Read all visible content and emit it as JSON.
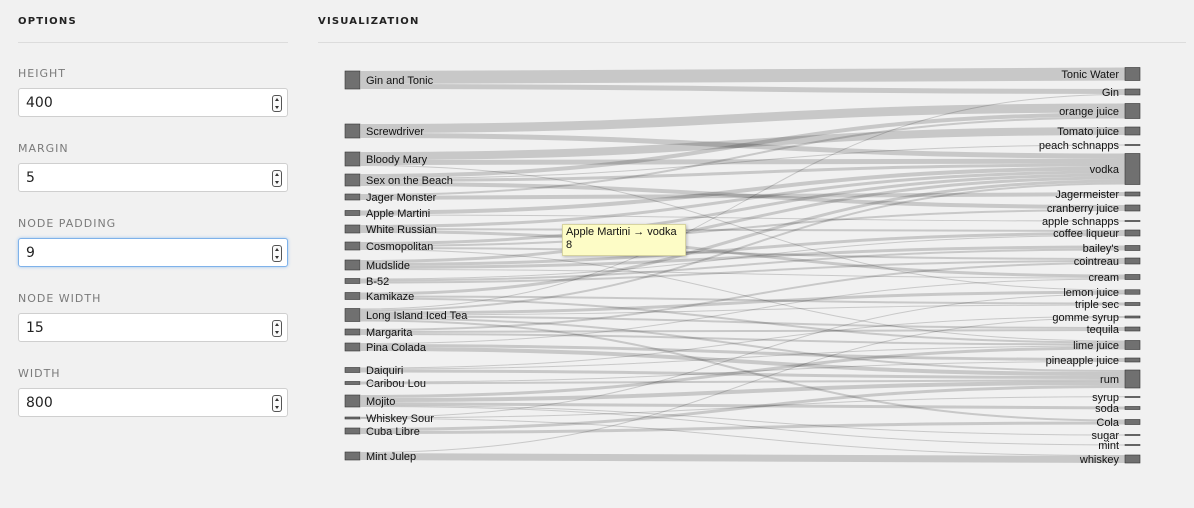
{
  "options": {
    "title": "OPTIONS",
    "fields": [
      {
        "label": "HEIGHT",
        "value": "400"
      },
      {
        "label": "MARGIN",
        "value": "5"
      },
      {
        "label": "NODE PADDING",
        "value": "9"
      },
      {
        "label": "NODE WIDTH",
        "value": "15"
      },
      {
        "label": "WIDTH",
        "value": "800"
      }
    ]
  },
  "visualization": {
    "title": "VISUALIZATION"
  },
  "tooltip": {
    "link": "Apple Martini → vodka",
    "value": "8"
  },
  "colors": {
    "node": "#707070",
    "node_border": "#333333",
    "link": "#000000",
    "tooltip_bg": "#fdfcc6"
  },
  "chart_data": {
    "type": "sankey",
    "sources": [
      "Gin and Tonic",
      "Screwdriver",
      "Bloody Mary",
      "Sex on the Beach",
      "Jager Monster",
      "Apple Martini",
      "White Russian",
      "Cosmopolitan",
      "Mudslide",
      "B-52",
      "Kamikaze",
      "Long Island Iced Tea",
      "Margarita",
      "Pina Colada",
      "Daiquiri",
      "Caribou Lou",
      "Mojito",
      "Whiskey Sour",
      "Cuba Libre",
      "Mint Julep"
    ],
    "targets": [
      "Tonic Water",
      "Gin",
      "orange juice",
      "Tomato juice",
      "peach schnapps",
      "vodka",
      "Jagermeister",
      "cranberry juice",
      "apple schnapps",
      "coffee liqueur",
      "bailey's",
      "cointreau",
      "cream",
      "lemon juice",
      "triple sec",
      "gomme syrup",
      "tequila",
      "lime juice",
      "pineapple juice",
      "rum",
      "syrup",
      "soda",
      "Cola",
      "sugar",
      "mint",
      "whiskey"
    ],
    "links": [
      [
        "Gin and Tonic",
        "Tonic Water",
        26
      ],
      [
        "Gin and Tonic",
        "Gin",
        10
      ],
      [
        "Screwdriver",
        "vodka",
        10
      ],
      [
        "Screwdriver",
        "orange juice",
        18
      ],
      [
        "Bloody Mary",
        "vodka",
        10
      ],
      [
        "Bloody Mary",
        "Tomato juice",
        16
      ],
      [
        "Bloody Mary",
        "lemon juice",
        2
      ],
      [
        "Sex on the Beach",
        "vodka",
        6
      ],
      [
        "Sex on the Beach",
        "peach schnapps",
        2
      ],
      [
        "Sex on the Beach",
        "orange juice",
        8
      ],
      [
        "Sex on the Beach",
        "cranberry juice",
        8
      ],
      [
        "Jager Monster",
        "Jagermeister",
        8
      ],
      [
        "Jager Monster",
        "orange juice",
        4
      ],
      [
        "Apple Martini",
        "vodka",
        8
      ],
      [
        "Apple Martini",
        "apple schnapps",
        2
      ],
      [
        "White Russian",
        "vodka",
        6
      ],
      [
        "White Russian",
        "coffee liqueur",
        4
      ],
      [
        "White Russian",
        "cream",
        6
      ],
      [
        "Cosmopolitan",
        "vodka",
        6
      ],
      [
        "Cosmopolitan",
        "cointreau",
        4
      ],
      [
        "Cosmopolitan",
        "cranberry juice",
        4
      ],
      [
        "Cosmopolitan",
        "lime juice",
        2
      ],
      [
        "Mudslide",
        "vodka",
        6
      ],
      [
        "Mudslide",
        "coffee liqueur",
        6
      ],
      [
        "Mudslide",
        "bailey's",
        6
      ],
      [
        "Mudslide",
        "cream",
        2
      ],
      [
        "B-52",
        "coffee liqueur",
        2
      ],
      [
        "B-52",
        "bailey's",
        4
      ],
      [
        "B-52",
        "cointreau",
        4
      ],
      [
        "Kamikaze",
        "vodka",
        6
      ],
      [
        "Kamikaze",
        "triple sec",
        4
      ],
      [
        "Kamikaze",
        "lime juice",
        4
      ],
      [
        "Long Island Iced Tea",
        "vodka",
        4
      ],
      [
        "Long Island Iced Tea",
        "Gin",
        2
      ],
      [
        "Long Island Iced Tea",
        "tequila",
        4
      ],
      [
        "Long Island Iced Tea",
        "rum",
        4
      ],
      [
        "Long Island Iced Tea",
        "triple sec",
        2
      ],
      [
        "Long Island Iced Tea",
        "Cola",
        4
      ],
      [
        "Long Island Iced Tea",
        "lemon juice",
        6
      ],
      [
        "Margarita",
        "tequila",
        4
      ],
      [
        "Margarita",
        "cointreau",
        4
      ],
      [
        "Margarita",
        "lime juice",
        4
      ],
      [
        "Pina Colada",
        "rum",
        8
      ],
      [
        "Pina Colada",
        "pineapple juice",
        6
      ],
      [
        "Pina Colada",
        "cream",
        2
      ],
      [
        "Daiquiri",
        "rum",
        6
      ],
      [
        "Daiquiri",
        "lime juice",
        2
      ],
      [
        "Daiquiri",
        "gomme syrup",
        2
      ],
      [
        "Caribou Lou",
        "rum",
        4
      ],
      [
        "Caribou Lou",
        "pineapple juice",
        2
      ],
      [
        "Mojito",
        "rum",
        8
      ],
      [
        "Mojito",
        "lime juice",
        6
      ],
      [
        "Mojito",
        "sugar",
        2
      ],
      [
        "Mojito",
        "mint",
        2
      ],
      [
        "Mojito",
        "soda",
        6
      ],
      [
        "Whiskey Sour",
        "whiskey",
        2
      ],
      [
        "Whiskey Sour",
        "lemon juice",
        1
      ],
      [
        "Whiskey Sour",
        "syrup",
        1
      ],
      [
        "Cuba Libre",
        "rum",
        6
      ],
      [
        "Cuba Libre",
        "Cola",
        6
      ],
      [
        "Mint Julep",
        "whiskey",
        14
      ],
      [
        "Mint Julep",
        "gomme syrup",
        2
      ]
    ]
  }
}
